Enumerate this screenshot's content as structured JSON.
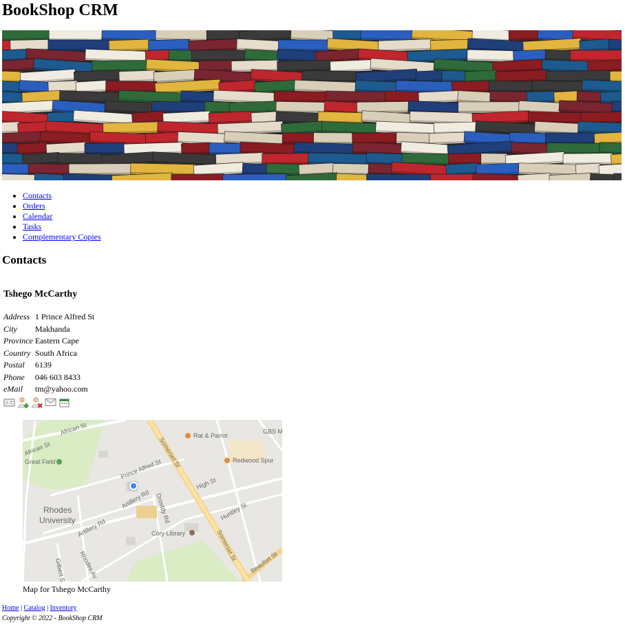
{
  "app": {
    "title": "BookShop CRM"
  },
  "banner": {
    "alt": "Stacks of books",
    "palette": [
      "#c0262d",
      "#1f3f7a",
      "#2f6b3a",
      "#f1ece0",
      "#e2b53e",
      "#8a1c22",
      "#2b5fbf",
      "#e6dccb",
      "#3a3a3a",
      "#d9cfb8",
      "#7a2530",
      "#1d5a8f"
    ]
  },
  "nav": {
    "items": [
      "Contacts",
      "Orders",
      "Calendar",
      "Tasks",
      "Complementary Copies"
    ]
  },
  "page": {
    "heading": "Contacts"
  },
  "contact": {
    "name": "Tshego McCarthy",
    "fields": [
      {
        "label": "Address",
        "value": "1 Prince Alfred St"
      },
      {
        "label": "City",
        "value": "Makhanda"
      },
      {
        "label": "Province",
        "value": "Eastern Cape"
      },
      {
        "label": "Country",
        "value": "South Africa"
      },
      {
        "label": "Postal",
        "value": "6139"
      },
      {
        "label": "Phone",
        "value": "046 603 8433"
      },
      {
        "label": "eMail",
        "value": "tm@yahoo.com"
      }
    ]
  },
  "actions": [
    {
      "name": "contact-card-icon"
    },
    {
      "name": "add-user-icon"
    },
    {
      "name": "delete-user-icon"
    },
    {
      "name": "email-icon"
    },
    {
      "name": "calendar-icon"
    }
  ],
  "map": {
    "caption": "Map for Tshego McCarthy",
    "labels": {
      "african_st_top": "African St",
      "african_st_left": "African St",
      "great_field": "Great Field",
      "rat_parrot": "Rat & Parrot",
      "gbs": "GBS M",
      "redwood_spur": "Redwood Spur",
      "somerset_st_top": "Somerset St",
      "somerset_st_bottom": "Somerset St",
      "prince_alfred_st": "Prince Alfred St",
      "high_st": "High St",
      "artillery_rd_mid": "Artillery Rd",
      "artillery_rd_low": "Artillery Rd",
      "drostdy_rd": "Drostdy Rd",
      "rhodes_1": "Rhodes",
      "rhodes_2": "University",
      "huntley_st": "Huntley St",
      "cory_library": "Cory Library",
      "rhodes_av": "Rhodes Av",
      "gilbert_st": "Gilbert St",
      "beaufort_st": "Beaufort St"
    }
  },
  "footer": {
    "links": [
      "Home",
      "Catalog",
      "Inventory"
    ],
    "separator": "|",
    "copyright": "Copyright © 2022 - BookShop CRM"
  }
}
